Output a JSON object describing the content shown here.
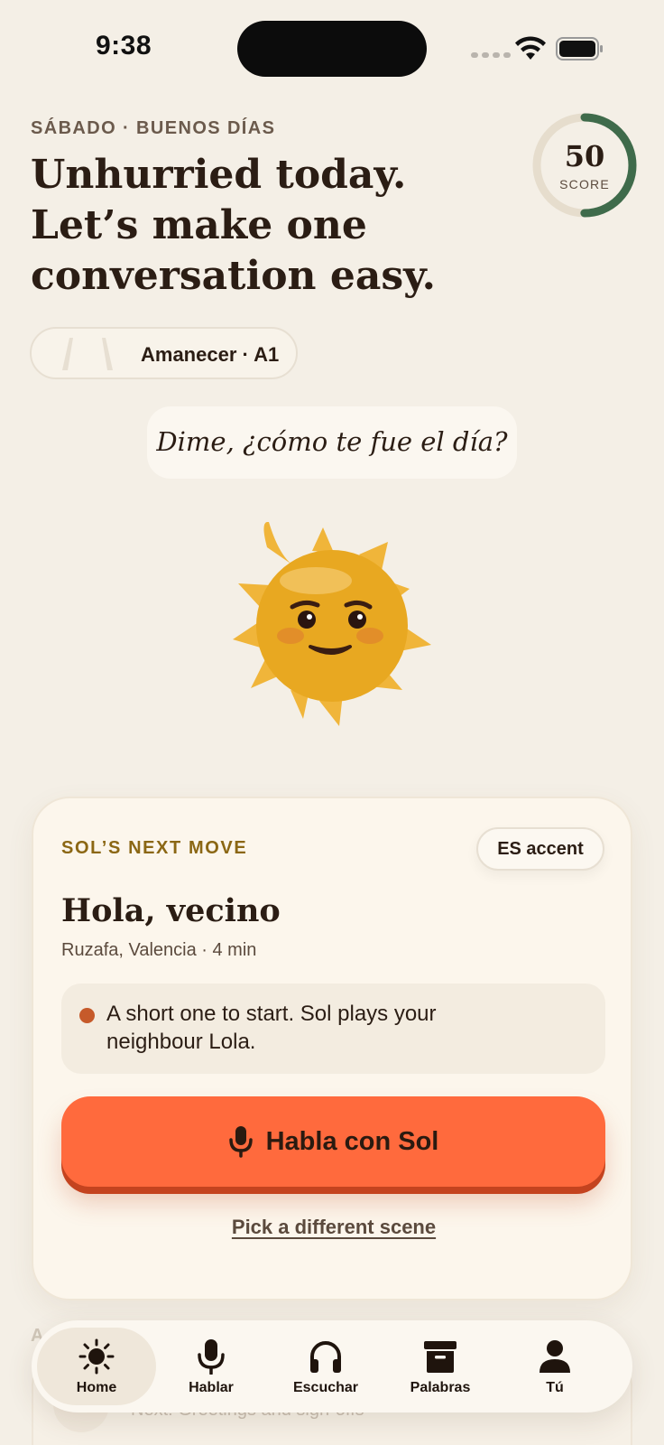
{
  "status_bar": {
    "time": "9:38"
  },
  "header": {
    "eyebrow": "SÁBADO · BUENOS DÍAS",
    "headline": "Unhurried today. Let’s make one conversation easy.",
    "score": {
      "value": "50",
      "label": "SCORE",
      "progress": 0.5
    },
    "level": "Amanecer · A1"
  },
  "speech_bubble": "Dime, ¿cómo te fue el día?",
  "card": {
    "eyebrow": "SOL’S NEXT MOVE",
    "accent": "ES accent",
    "title": "Hola, vecino",
    "meta": "Ruzafa, Valencia · 4 min",
    "note": "A short one to start. Sol plays your neighbour Lola.",
    "cta": "Habla con Sol",
    "alt_link": "Pick a different scene"
  },
  "behind_nav": {
    "section_label": "A",
    "badge": "VA",
    "text": "Next: Greetings and sign-offs"
  },
  "tabbar": {
    "tabs": [
      {
        "label": "Home",
        "icon": "sun-icon",
        "active": true
      },
      {
        "label": "Hablar",
        "icon": "microphone-icon",
        "active": false
      },
      {
        "label": "Escuchar",
        "icon": "headphones-icon",
        "active": false
      },
      {
        "label": "Palabras",
        "icon": "archive-box-icon",
        "active": false
      },
      {
        "label": "Tú",
        "icon": "person-icon",
        "active": false
      }
    ]
  },
  "colors": {
    "background": "#f4efe6",
    "accent_orange": "#ff6a3d",
    "score_green": "#3f6b4b",
    "eyebrow_gold": "#8b6714",
    "sun_yellow": "#e8a821"
  }
}
